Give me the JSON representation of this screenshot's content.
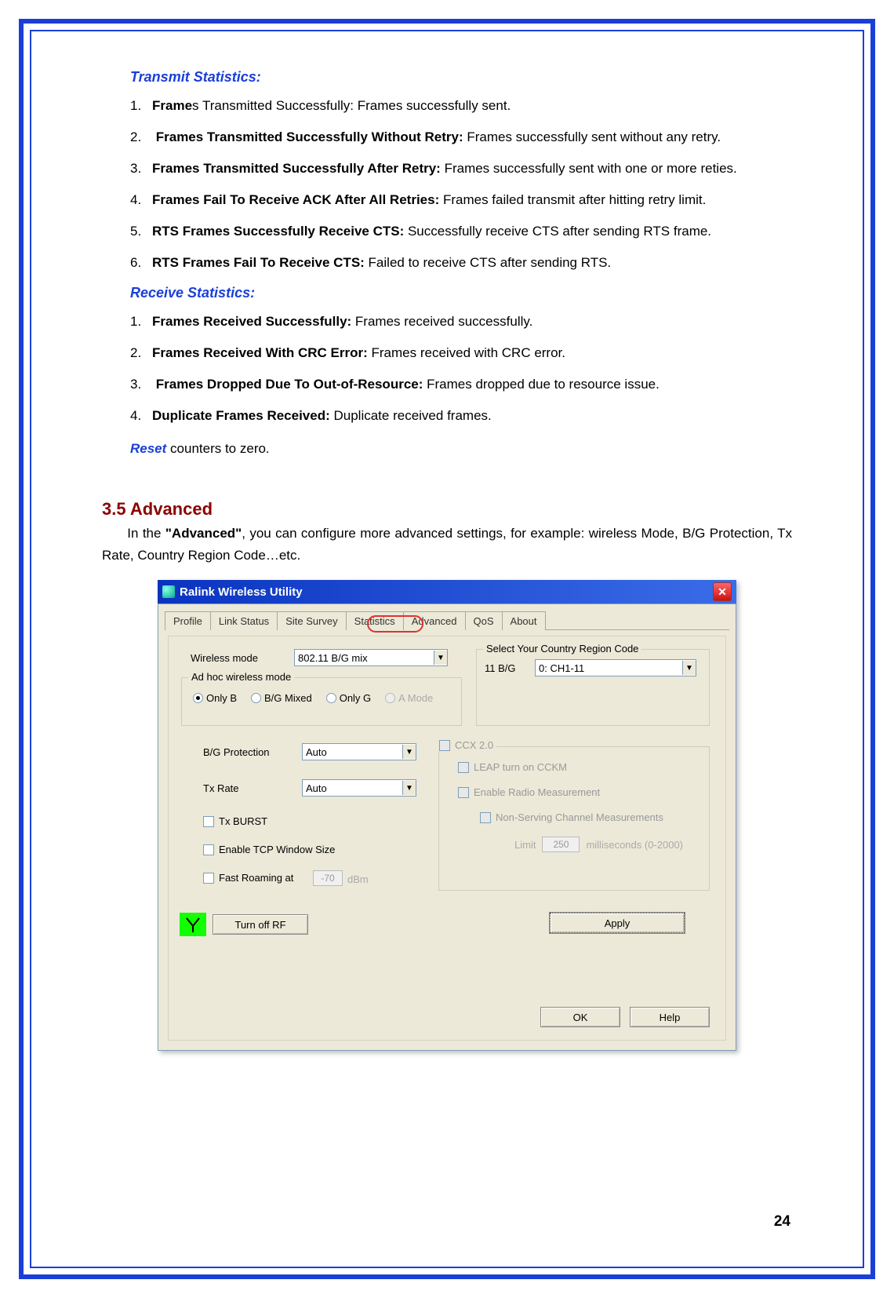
{
  "sections": {
    "transmit_title": "Transmit Statistics:",
    "transmit_items": [
      {
        "n": "1.",
        "bold": "Frame",
        "rest": "s Transmitted Successfully: Frames successfully sent."
      },
      {
        "n": "2.",
        "bold": "Frames Transmitted Successfully Without Retry:",
        "rest": " Frames successfully sent without any retry."
      },
      {
        "n": "3.",
        "bold": "Frames Transmitted Successfully After Retry:",
        "rest": " Frames successfully sent with one or     more reties."
      },
      {
        "n": "4.",
        "bold": "Frames Fail To Receive ACK After All Retries:",
        "rest": " Frames failed transmit after hitting retry limit."
      },
      {
        "n": "5.",
        "bold": "RTS Frames Successfully Receive CTS:",
        "rest": " Successfully receive CTS after sending RTS frame."
      },
      {
        "n": "6.",
        "bold": "RTS Frames Fail To Receive CTS:",
        "rest": " Failed to receive CTS after sending RTS."
      }
    ],
    "receive_title": "Receive Statistics:",
    "receive_items": [
      {
        "n": "1.",
        "bold": "Frames Received Successfully:",
        "rest": " Frames received successfully."
      },
      {
        "n": "2.",
        "bold": "Frames Received With CRC Error:",
        "rest": " Frames received with CRC error."
      },
      {
        "n": "3.",
        "bold": "Frames Dropped Due To Out-of-Resource:",
        "rest": " Frames dropped due to resource issue."
      },
      {
        "n": "4.",
        "bold": "Duplicate Frames Received:",
        "rest": " Duplicate received frames."
      }
    ],
    "reset_bold": "Reset",
    "reset_rest": " counters to zero."
  },
  "heading": "3.5  Advanced",
  "intro_pre": "In the ",
  "intro_bold": "\"Advanced\"",
  "intro_post": ", you can configure more advanced settings, for example: wireless Mode, B/G Protection, Tx Rate, Country Region Code…etc.",
  "dlg": {
    "title": "Ralink Wireless Utility",
    "close": "✕",
    "tabs": [
      "Profile",
      "Link Status",
      "Site Survey",
      "Statistics",
      "Advanced",
      "QoS",
      "About"
    ],
    "wireless_mode_lbl": "Wireless mode",
    "wireless_mode_val": "802.11 B/G mix",
    "adhoc_legend": "Ad hoc wireless mode",
    "radios": {
      "only_b": "Only B",
      "bg_mixed": "B/G Mixed",
      "only_g": "Only G",
      "a_mode": "A Mode"
    },
    "region_legend": "Select Your Country Region Code",
    "region_lbl": "11 B/G",
    "region_val": "0: CH1-11",
    "bg_prot_lbl": "B/G Protection",
    "bg_prot_val": "Auto",
    "txrate_lbl": "Tx Rate",
    "txrate_val": "Auto",
    "txburst": "Tx BURST",
    "tcpwin": "Enable TCP Window Size",
    "fastroam": "Fast Roaming at",
    "fastroam_val": "-70",
    "fastroam_unit": "dBm",
    "ccx_legend": "CCX 2.0",
    "ccx_leap": "LEAP turn on CCKM",
    "ccx_radio": "Enable Radio Measurement",
    "ccx_nonserv": "Non-Serving Channel Measurements",
    "ccx_limit_lbl": "Limit",
    "ccx_limit_val": "250",
    "ccx_limit_unit": "milliseconds (0-2000)",
    "rf_btn": "Turn off RF",
    "apply": "Apply",
    "ok": "OK",
    "help": "Help"
  },
  "page_num": "24"
}
